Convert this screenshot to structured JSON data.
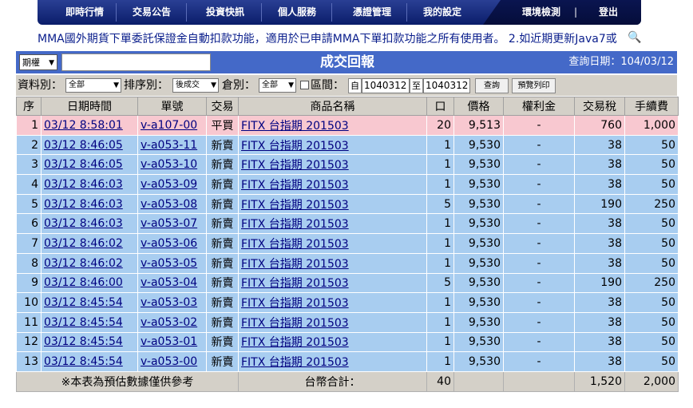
{
  "nav": {
    "items": [
      "即時行情",
      "交易公告",
      "投資快訊",
      "個人服務",
      "憑證管理",
      "我的設定"
    ],
    "right_items": [
      "環境檢測",
      "|",
      "登出"
    ]
  },
  "marquee": "MMA國外期貨下單委託保證金自動扣款功能，適用於已申請MMA下單扣款功能之所有使用者。 2.如近期更新Java7或",
  "header": {
    "market_select": "期權",
    "title": "成交回報",
    "query_date": "查詢日期：104/03/12"
  },
  "filters": {
    "type_label": "資料別：",
    "type_value": "全部",
    "sort_label": "排序別：",
    "sort_value": "後成交",
    "warehouse_label": "倉別：",
    "warehouse_value": "全部",
    "range_label": "區間：",
    "from_label": "自",
    "from_value": "1040312",
    "to_label": "至",
    "to_value": "1040312",
    "query_button": "查詢",
    "print_button": "預覽列印"
  },
  "table": {
    "headers": [
      "序",
      "日期時間",
      "單號",
      "交易",
      "商品名稱",
      "口",
      "價格",
      "權利金",
      "交易稅",
      "手續費"
    ],
    "rows": [
      {
        "seq": "1",
        "time": "03/12 8:58:01",
        "order": "v-a107-00",
        "trade": "平買",
        "product": "FITX 台指期 201503",
        "qty": "20",
        "price": "9,513",
        "premium": "-",
        "tax": "760",
        "fee": "1,000"
      },
      {
        "seq": "2",
        "time": "03/12 8:46:05",
        "order": "v-a053-11",
        "trade": "新賣",
        "product": "FITX 台指期 201503",
        "qty": "1",
        "price": "9,530",
        "premium": "-",
        "tax": "38",
        "fee": "50"
      },
      {
        "seq": "3",
        "time": "03/12 8:46:05",
        "order": "v-a053-10",
        "trade": "新賣",
        "product": "FITX 台指期 201503",
        "qty": "1",
        "price": "9,530",
        "premium": "-",
        "tax": "38",
        "fee": "50"
      },
      {
        "seq": "4",
        "time": "03/12 8:46:03",
        "order": "v-a053-09",
        "trade": "新賣",
        "product": "FITX 台指期 201503",
        "qty": "1",
        "price": "9,530",
        "premium": "-",
        "tax": "38",
        "fee": "50"
      },
      {
        "seq": "5",
        "time": "03/12 8:46:03",
        "order": "v-a053-08",
        "trade": "新賣",
        "product": "FITX 台指期 201503",
        "qty": "5",
        "price": "9,530",
        "premium": "-",
        "tax": "190",
        "fee": "250"
      },
      {
        "seq": "6",
        "time": "03/12 8:46:03",
        "order": "v-a053-07",
        "trade": "新賣",
        "product": "FITX 台指期 201503",
        "qty": "1",
        "price": "9,530",
        "premium": "-",
        "tax": "38",
        "fee": "50"
      },
      {
        "seq": "7",
        "time": "03/12 8:46:02",
        "order": "v-a053-06",
        "trade": "新賣",
        "product": "FITX 台指期 201503",
        "qty": "1",
        "price": "9,530",
        "premium": "-",
        "tax": "38",
        "fee": "50"
      },
      {
        "seq": "8",
        "time": "03/12 8:46:02",
        "order": "v-a053-05",
        "trade": "新賣",
        "product": "FITX 台指期 201503",
        "qty": "1",
        "price": "9,530",
        "premium": "-",
        "tax": "38",
        "fee": "50"
      },
      {
        "seq": "9",
        "time": "03/12 8:46:00",
        "order": "v-a053-04",
        "trade": "新賣",
        "product": "FITX 台指期 201503",
        "qty": "5",
        "price": "9,530",
        "premium": "-",
        "tax": "190",
        "fee": "250"
      },
      {
        "seq": "10",
        "time": "03/12 8:45:54",
        "order": "v-a053-03",
        "trade": "新賣",
        "product": "FITX 台指期 201503",
        "qty": "1",
        "price": "9,530",
        "premium": "-",
        "tax": "38",
        "fee": "50"
      },
      {
        "seq": "11",
        "time": "03/12 8:45:54",
        "order": "v-a053-02",
        "trade": "新賣",
        "product": "FITX 台指期 201503",
        "qty": "1",
        "price": "9,530",
        "premium": "-",
        "tax": "38",
        "fee": "50"
      },
      {
        "seq": "12",
        "time": "03/12 8:45:54",
        "order": "v-a053-01",
        "trade": "新賣",
        "product": "FITX 台指期 201503",
        "qty": "1",
        "price": "9,530",
        "premium": "-",
        "tax": "38",
        "fee": "50"
      },
      {
        "seq": "13",
        "time": "03/12 8:45:54",
        "order": "v-a053-00",
        "trade": "新賣",
        "product": "FITX 台指期 201503",
        "qty": "1",
        "price": "9,530",
        "premium": "-",
        "tax": "38",
        "fee": "50"
      }
    ],
    "footer": {
      "note": "※本表為預估數據僅供參考",
      "total_label": "台幣合計：",
      "total_qty": "40",
      "total_tax": "1,520",
      "total_fee": "2,000"
    }
  },
  "colors": {
    "nav_bg": "#0b1d6a",
    "title_bg": "#4469c8",
    "row_blue": "#a8cdf0",
    "row_pink": "#f8c8d0",
    "gray_bar": "#d4d0c8"
  }
}
